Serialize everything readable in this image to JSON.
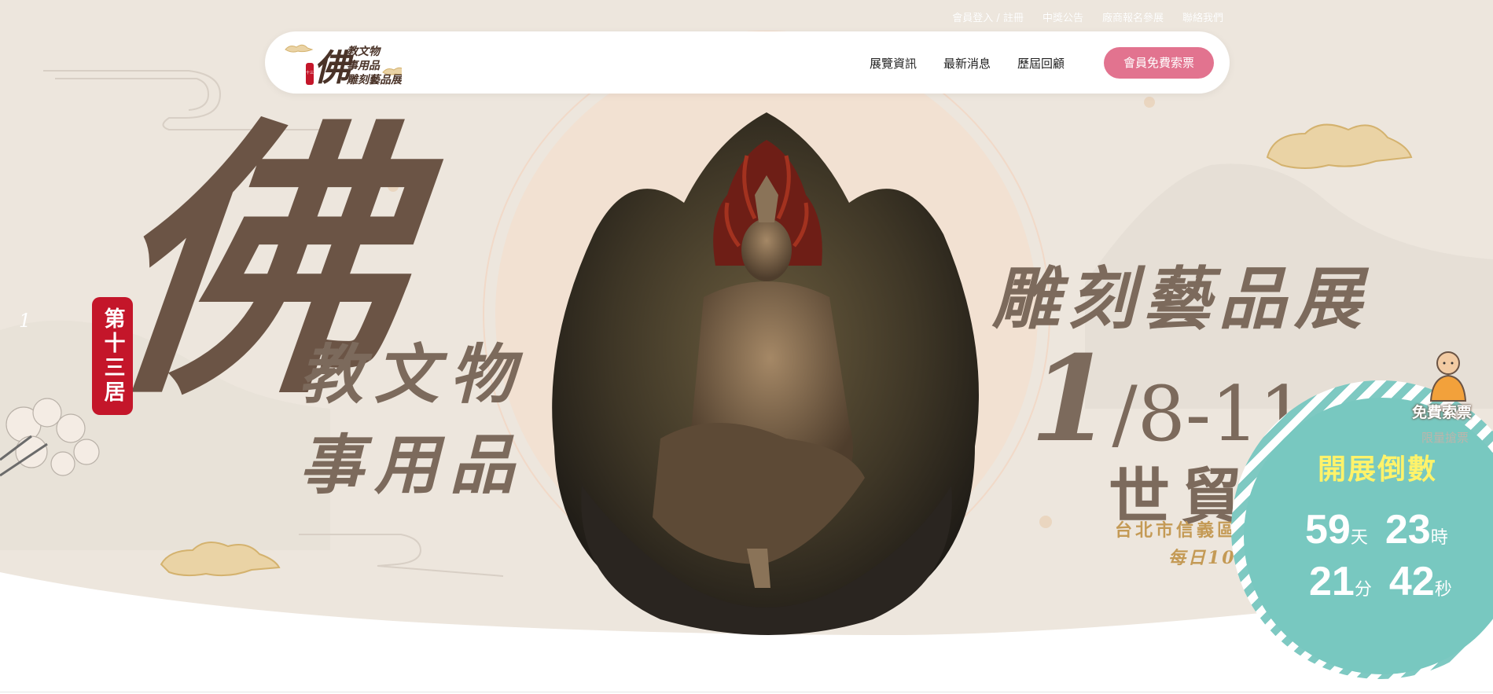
{
  "top_links": [
    {
      "label": "會員登入 / 註冊"
    },
    {
      "label": "中獎公告"
    },
    {
      "label": "廠商報名參展"
    },
    {
      "label": "聯絡我們"
    }
  ],
  "nav": {
    "items": [
      {
        "label": "展覽資訊"
      },
      {
        "label": "最新消息"
      },
      {
        "label": "歷屆回顧"
      }
    ],
    "cta_label": "會員免費索票"
  },
  "logo": {
    "badge": "第十三屆",
    "big_char": "佛",
    "line1": "教文物",
    "line2": "事用品",
    "line3": "雕刻藝品展"
  },
  "hero": {
    "slide_number": "1",
    "big_char": "佛",
    "seal_text": "第十三居",
    "subtitle_line1": "教文物",
    "subtitle_line2": "事用品",
    "right_title": "雕刻藝品展",
    "date_month": "1",
    "date_rest": "/8-11",
    "venue": "世貿一",
    "address": "台北市信義區信",
    "hours": "每日10:00"
  },
  "countdown": {
    "free_ticket": "免費索票",
    "limited": "限量搶票",
    "title": "開展倒數",
    "days": "59",
    "days_unit": "天",
    "hours": "23",
    "hours_unit": "時",
    "minutes": "21",
    "minutes_unit": "分",
    "seconds": "42",
    "seconds_unit": "秒"
  },
  "colors": {
    "hero_bg": "#ede6dd",
    "brown": "#6b5445",
    "gold": "#c49a55",
    "cta_pink": "#e2738f",
    "teal": "#78c8c0",
    "countdown_title": "#fff36a",
    "seal_red": "#c4162a"
  }
}
